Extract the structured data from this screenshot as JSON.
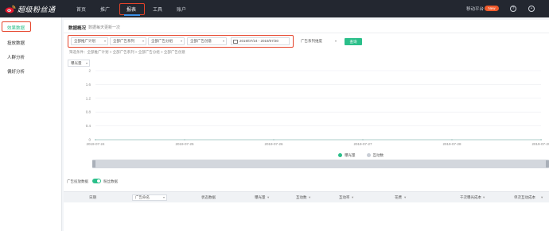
{
  "app": {
    "logo_text": "超级粉丝通",
    "colors": {
      "brand_dark": "#232730",
      "accent_green": "#2bbf8a",
      "highlight_red": "#e5432a",
      "accent_blue": "#3a8ee6"
    }
  },
  "nav": {
    "items": [
      {
        "label": "首页"
      },
      {
        "label": "推广"
      },
      {
        "label": "报表"
      },
      {
        "label": "工具"
      },
      {
        "label": "账户"
      }
    ],
    "platform_label": "移动平台",
    "new_badge": "New",
    "icons": [
      "help-icon",
      "user-icon"
    ]
  },
  "sidebar": {
    "items": [
      {
        "label": "效果数据"
      },
      {
        "label": "投放数据"
      },
      {
        "label": "人群分析"
      },
      {
        "label": "偏好分析"
      }
    ]
  },
  "breadcrumb": {
    "title": "数据概况",
    "subtitle": "数据每天更新一次"
  },
  "filters": {
    "dropdowns": [
      {
        "label": "全部推广计划"
      },
      {
        "label": "全部广告系列"
      },
      {
        "label": "全部广告分组"
      },
      {
        "label": "全部广告创意"
      }
    ],
    "date_range": "2019/07/24 - 2019/07/30",
    "granularity": "广告系列维度",
    "query_button": "查询",
    "condition_text": "筛选条件：全部推广计划 > 全部广告系列 > 全部广告分组 > 全部广告创意"
  },
  "metric_select": {
    "value": "曝光量"
  },
  "chart_data": {
    "type": "line",
    "x": [
      "2019-07-24",
      "2019-07-25",
      "2019-07-26",
      "2019-07-27",
      "2019-07-28",
      "2019-07-29"
    ],
    "ylim": [
      0,
      2
    ],
    "yticks": [
      "2",
      "1.6",
      "1.2",
      "0.8",
      "0.4",
      "0"
    ],
    "series": [
      {
        "name": "曝光量",
        "values": [
          0,
          0,
          0,
          0,
          0,
          0
        ],
        "color": "#2bbf8a"
      },
      {
        "name": "互动数",
        "values": [
          0,
          0,
          0,
          0,
          0,
          0
        ],
        "color": "#c9ced6"
      }
    ],
    "grid": true,
    "legend": "bottom-center"
  },
  "table": {
    "toggle_label": "广告投放数据",
    "toggle_text": "粉丝数据",
    "headers": [
      "日期",
      "广告命名",
      "状态数据",
      "曝光量",
      "互动数",
      "互动率",
      "花费",
      "千次曝光成本",
      "单次互动成本"
    ],
    "select_value": "广告命名"
  }
}
